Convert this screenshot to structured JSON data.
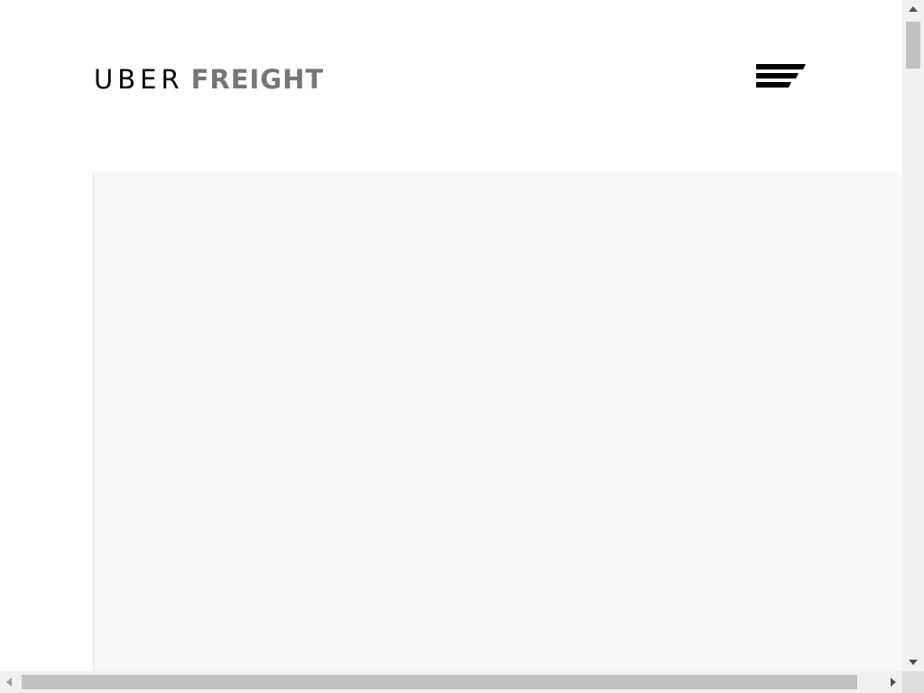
{
  "header": {
    "logo": {
      "part1": "UBER",
      "part2": "FREIGHT",
      "colors": {
        "part1": "#000000",
        "part2": "#767676"
      }
    },
    "menu_button": {
      "icon": "hamburger-menu-icon"
    }
  },
  "content_panel": {
    "background": "#f8f8f8"
  },
  "scrollbars": {
    "vertical": {
      "up_icon": "arrow-up-icon",
      "down_icon": "arrow-down-icon"
    },
    "horizontal": {
      "left_icon": "arrow-left-icon",
      "right_icon": "arrow-right-icon"
    }
  }
}
